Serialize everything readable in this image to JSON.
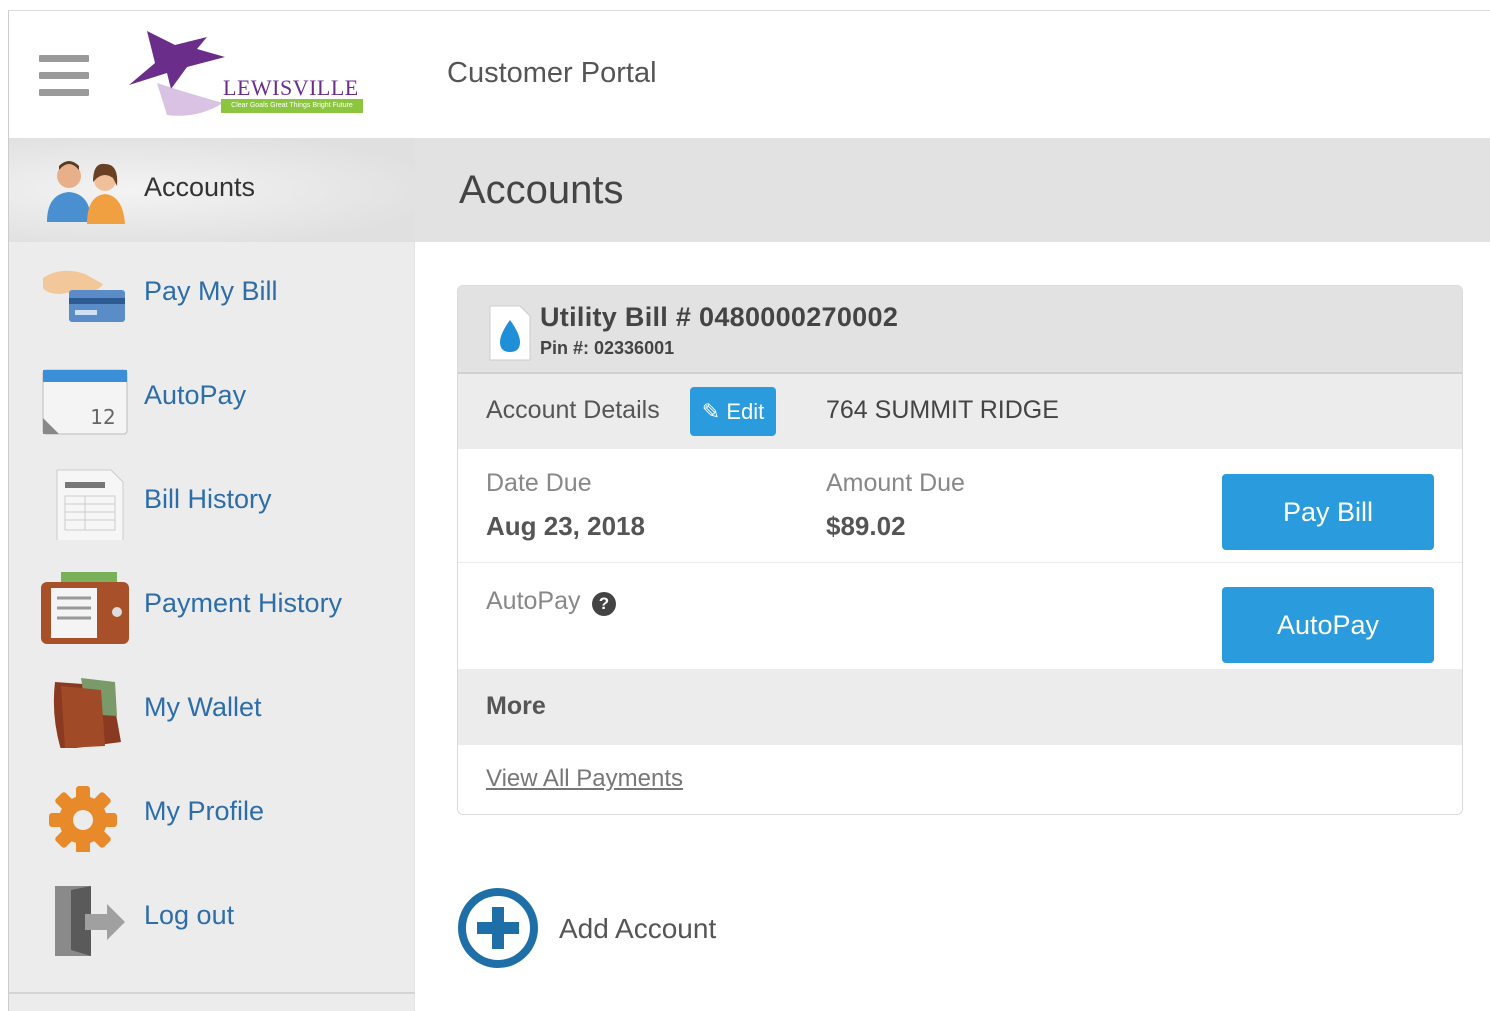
{
  "header": {
    "logo_text": "LEWISVILLE",
    "logo_tagline": "Clear Goals Great Things Bright Future",
    "title": "Customer Portal"
  },
  "sidebar": {
    "items": [
      {
        "label": "Accounts",
        "icon": "accounts-icon",
        "active": true
      },
      {
        "label": "Pay My Bill",
        "icon": "pay-bill-icon",
        "active": false
      },
      {
        "label": "AutoPay",
        "icon": "calendar-icon",
        "active": false
      },
      {
        "label": "Bill History",
        "icon": "invoice-icon",
        "active": false
      },
      {
        "label": "Payment History",
        "icon": "payment-history-icon",
        "active": false
      },
      {
        "label": "My Wallet",
        "icon": "wallet-icon",
        "active": false
      },
      {
        "label": "My Profile",
        "icon": "gear-icon",
        "active": false
      },
      {
        "label": "Log out",
        "icon": "logout-icon",
        "active": false
      }
    ]
  },
  "main": {
    "page_title": "Accounts",
    "account": {
      "bill_title": "Utility Bill # 0480000270002",
      "pin": "Pin #: 02336001",
      "details_label": "Account Details",
      "edit_label": "Edit",
      "address": "764 SUMMIT RIDGE",
      "date_due_label": "Date Due",
      "date_due_value": "Aug 23, 2018",
      "amount_due_label": "Amount Due",
      "amount_due_value": "$89.02",
      "pay_bill_button": "Pay Bill",
      "autopay_label": "AutoPay",
      "autopay_button": "AutoPay",
      "more_label": "More",
      "view_payments_link": "View All Payments"
    },
    "add_account_label": "Add Account"
  },
  "colors": {
    "accent": "#2a9bdc",
    "nav_link": "#2d6da8",
    "brand_purple": "#6b2d8a",
    "brand_green": "#8cc63f"
  }
}
